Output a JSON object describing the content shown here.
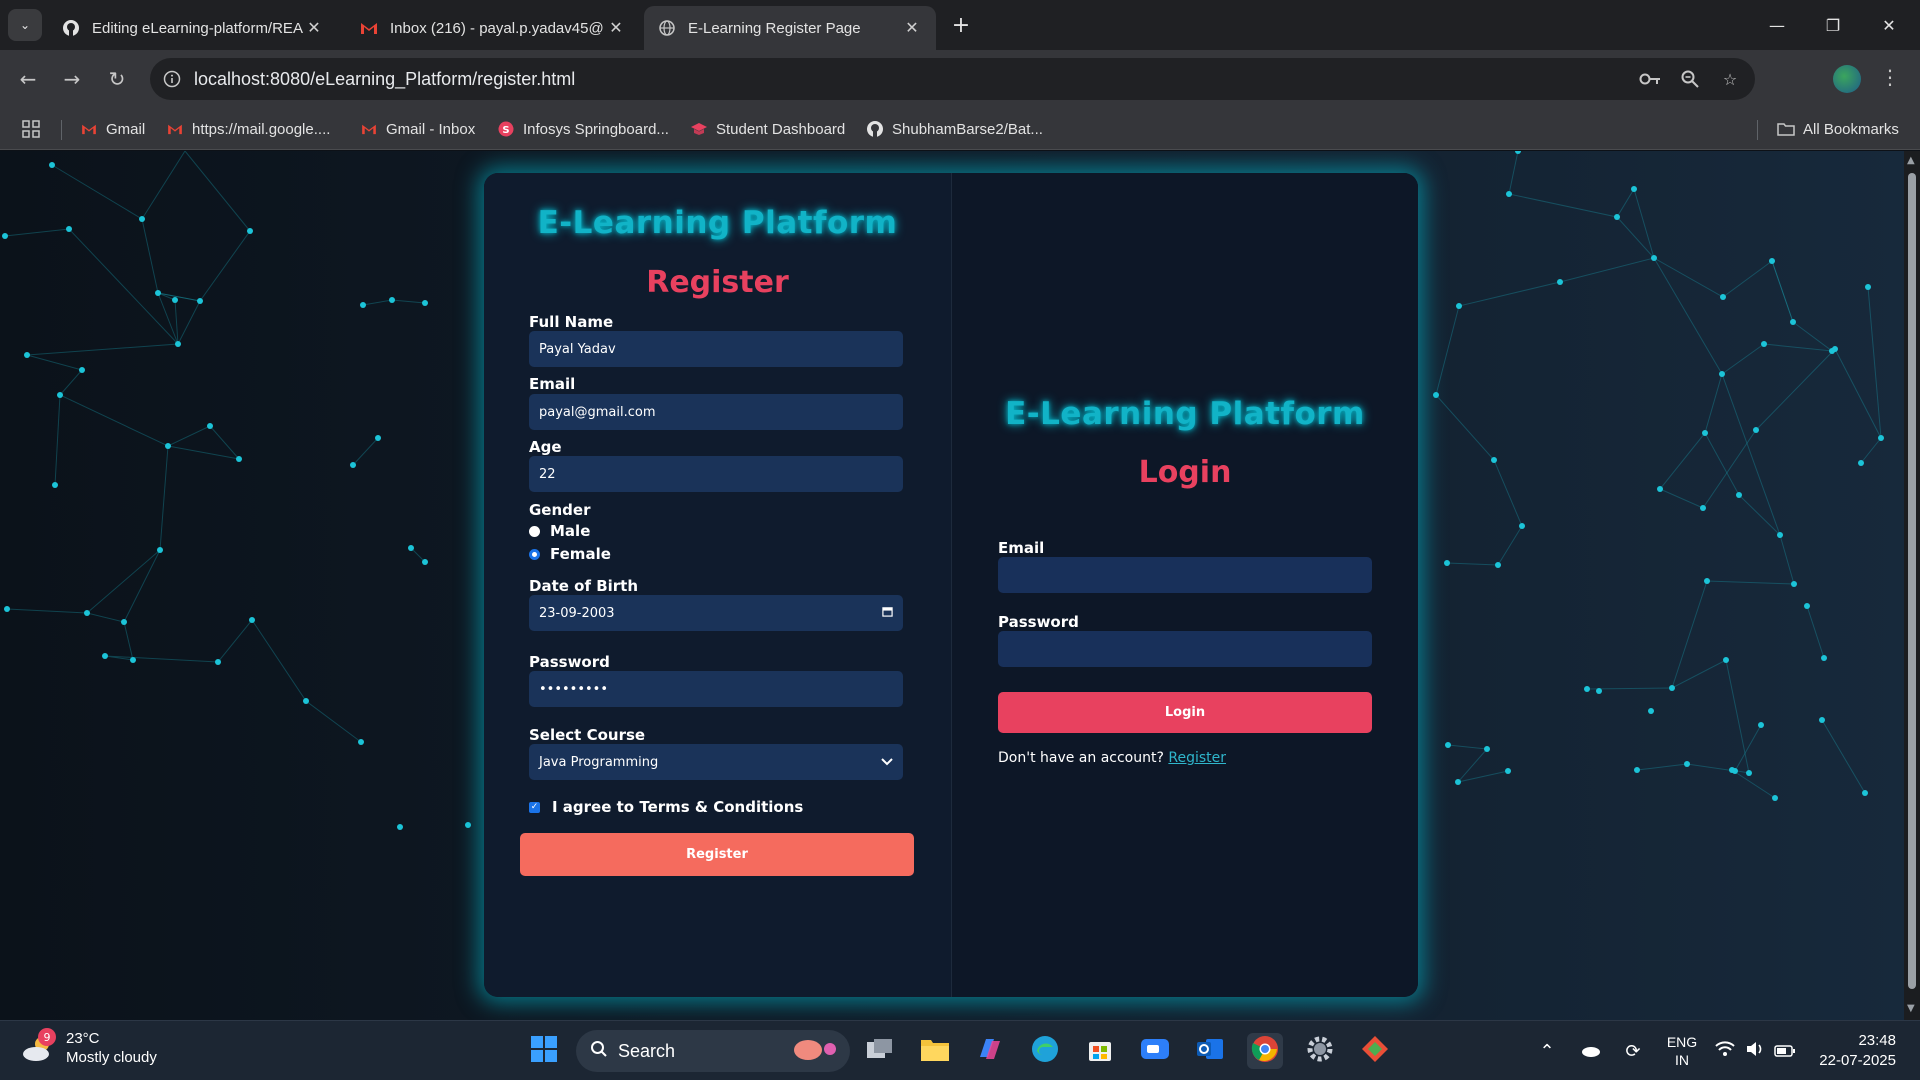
{
  "browser": {
    "tabs": [
      {
        "title": "Editing eLearning-platform/REA",
        "icon": "github-icon"
      },
      {
        "title": "Inbox (216) - payal.p.yadav45@",
        "icon": "gmail-icon"
      },
      {
        "title": "E-Learning Register Page",
        "icon": "globe-icon"
      }
    ],
    "url": "localhost:8080/eLearning_Platform/register.html",
    "bookmarks": [
      {
        "label": "Gmail",
        "icon": "gmail-icon"
      },
      {
        "label": "https://mail.google....",
        "icon": "gmail-icon"
      },
      {
        "label": "Gmail - Inbox",
        "icon": "gmail-icon"
      },
      {
        "label": "Infosys Springboard...",
        "icon": "springboard-icon"
      },
      {
        "label": "Student Dashboard",
        "icon": "graduation-cap-icon"
      },
      {
        "label": "ShubhamBarse2/Bat...",
        "icon": "github-icon"
      }
    ],
    "all_bookmarks": "All Bookmarks"
  },
  "register": {
    "brand": "E-Learning Platform",
    "heading": "Register",
    "full_name_label": "Full Name",
    "full_name_value": "Payal Yadav",
    "email_label": "Email",
    "email_value": "payal@gmail.com",
    "age_label": "Age",
    "age_value": "22",
    "gender_label": "Gender",
    "gender_options": [
      "Male",
      "Female"
    ],
    "gender_selected": "Female",
    "dob_label": "Date of Birth",
    "dob_value": "23-09-2003",
    "password_label": "Password",
    "password_value": "•••••••••",
    "course_label": "Select Course",
    "course_value": "Java Programming",
    "terms_label": "I agree to Terms & Conditions",
    "terms_checked": true,
    "submit_label": "Register"
  },
  "login": {
    "brand": "E-Learning Platform",
    "heading": "Login",
    "email_label": "Email",
    "password_label": "Password",
    "submit_label": "Login",
    "prompt_text": "Don't have an account?",
    "register_link": "Register"
  },
  "taskbar": {
    "weather_temp": "23°C",
    "weather_desc": "Mostly cloudy",
    "weather_badge": "9",
    "search_label": "Search",
    "language_top": "ENG",
    "language_bottom": "IN",
    "time": "23:48",
    "date": "22-07-2025"
  },
  "colors": {
    "brand_cyan": "#11b3c7",
    "heading_red": "#e8415f",
    "register_button": "#f56b5e",
    "input_bg": "#1a3359"
  }
}
